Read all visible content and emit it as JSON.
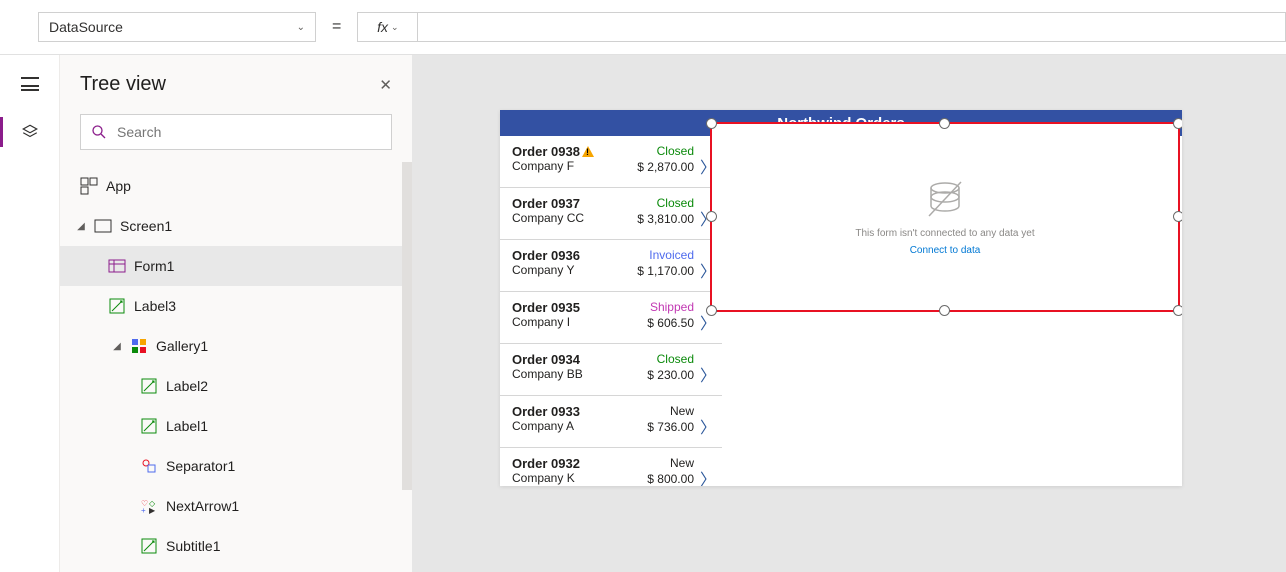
{
  "formula": {
    "prop": "DataSource",
    "fx_label": "fx",
    "value": ""
  },
  "treeview": {
    "title": "Tree view",
    "search_placeholder": "Search",
    "items": [
      {
        "label": "App"
      },
      {
        "label": "Screen1"
      },
      {
        "label": "Form1"
      },
      {
        "label": "Label3"
      },
      {
        "label": "Gallery1"
      },
      {
        "label": "Label2"
      },
      {
        "label": "Label1"
      },
      {
        "label": "Separator1"
      },
      {
        "label": "NextArrow1"
      },
      {
        "label": "Subtitle1"
      }
    ]
  },
  "app": {
    "header": "Northwind Orders",
    "gallery": [
      {
        "title": "Order 0938",
        "company": "Company F",
        "status": "Closed",
        "status_cls": "st-closed",
        "amount": "$ 2,870.00",
        "warn": true
      },
      {
        "title": "Order 0937",
        "company": "Company CC",
        "status": "Closed",
        "status_cls": "st-closed",
        "amount": "$ 3,810.00",
        "warn": false
      },
      {
        "title": "Order 0936",
        "company": "Company Y",
        "status": "Invoiced",
        "status_cls": "st-invoiced",
        "amount": "$ 1,170.00",
        "warn": false
      },
      {
        "title": "Order 0935",
        "company": "Company I",
        "status": "Shipped",
        "status_cls": "st-shipped",
        "amount": "$ 606.50",
        "warn": false
      },
      {
        "title": "Order 0934",
        "company": "Company BB",
        "status": "Closed",
        "status_cls": "st-closed",
        "amount": "$ 230.00",
        "warn": false
      },
      {
        "title": "Order 0933",
        "company": "Company A",
        "status": "New",
        "status_cls": "st-new",
        "amount": "$ 736.00",
        "warn": false
      },
      {
        "title": "Order 0932",
        "company": "Company K",
        "status": "New",
        "status_cls": "st-new",
        "amount": "$ 800.00",
        "warn": false
      }
    ],
    "form_empty": {
      "msg": "This form isn't connected to any data yet",
      "link": "Connect to data"
    }
  }
}
